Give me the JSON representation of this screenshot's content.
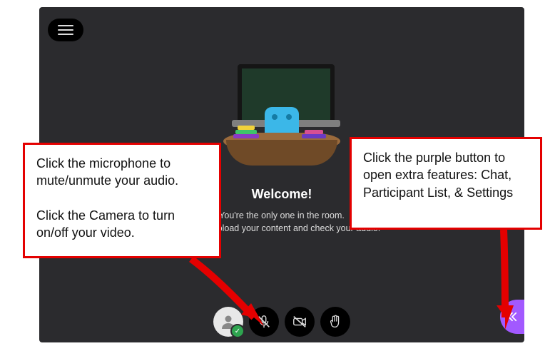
{
  "app": {
    "welcome_heading": "Welcome!",
    "welcome_line1": "You're the only one in the room.",
    "welcome_line2": "tarted! Upload your content and check your audio.",
    "menu_name": "menu",
    "toolbar": {
      "avatar_name": "my-status",
      "avatar_badge": "✓",
      "mic_name": "microphone-toggle",
      "camera_name": "camera-toggle",
      "raise_hand_name": "raise-hand"
    },
    "panel_button_name": "open-collaborate-panel"
  },
  "annotations": {
    "left": "Click the microphone to mute/unmute your audio.\n\nClick the Camera to turn on/off your video.",
    "right": "Click the purple button to open extra features: Chat, Participant List, & Settings"
  }
}
